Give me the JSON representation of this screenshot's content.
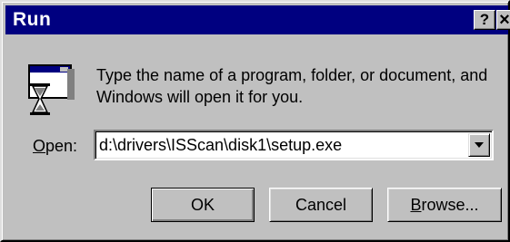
{
  "window": {
    "title": "Run",
    "help_label": "?",
    "close_label": "×"
  },
  "description": {
    "line1": "Type the name of a program, folder, or document, and",
    "line2": "Windows will open it for you."
  },
  "open": {
    "label_accel": "O",
    "label_rest": "pen:",
    "value": "d:\\drivers\\ISScan\\disk1\\setup.exe"
  },
  "buttons": {
    "ok": "OK",
    "cancel": "Cancel",
    "browse_accel": "B",
    "browse_rest": "rowse..."
  },
  "colors": {
    "titlebar": "#000080",
    "face": "#c0c0c0"
  }
}
